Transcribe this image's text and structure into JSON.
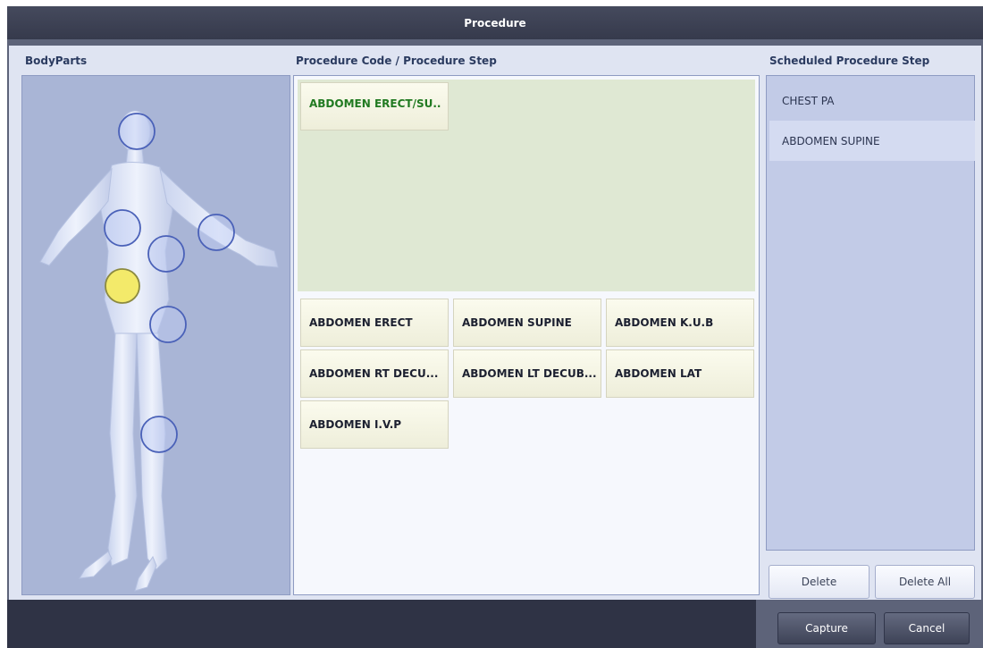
{
  "dialog": {
    "title": "Procedure"
  },
  "sections": {
    "body_parts": "BodyParts",
    "procedure_code": "Procedure Code / Procedure Step",
    "scheduled": "Scheduled Procedure Step"
  },
  "body_regions": [
    {
      "name": "head",
      "state": "normal"
    },
    {
      "name": "right-chest",
      "state": "normal"
    },
    {
      "name": "left-arm",
      "state": "normal"
    },
    {
      "name": "left-chest",
      "state": "normal"
    },
    {
      "name": "abdomen",
      "state": "selected"
    },
    {
      "name": "pelvis",
      "state": "normal"
    },
    {
      "name": "knee",
      "state": "normal"
    }
  ],
  "colors": {
    "region_selected": "#f3ea6a",
    "region_normal_stroke": "#4a61b8",
    "selected_code_text": "#217a21"
  },
  "procedure_codes": {
    "selected": "ABDOMEN ERECT/SU..",
    "steps": [
      "ABDOMEN ERECT",
      "ABDOMEN SUPINE",
      "ABDOMEN K.U.B",
      "ABDOMEN RT DECU...",
      "ABDOMEN LT DECUB...",
      "ABDOMEN LAT",
      "ABDOMEN I.V.P"
    ]
  },
  "scheduled_steps": [
    {
      "label": "CHEST PA",
      "active": false
    },
    {
      "label": "ABDOMEN SUPINE",
      "active": true
    }
  ],
  "buttons": {
    "delete": "Delete",
    "delete_all": "Delete All",
    "capture": "Capture",
    "cancel": "Cancel"
  }
}
